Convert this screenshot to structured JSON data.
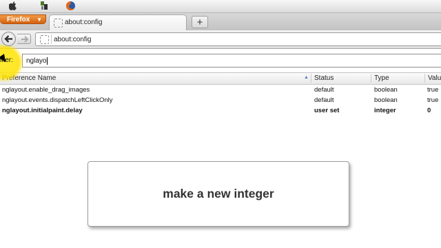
{
  "menubar": {
    "icons": [
      "apple-icon",
      "app-icon",
      "firefox-icon"
    ]
  },
  "firefox_button": {
    "label": "Firefox"
  },
  "tab": {
    "title": "about:config"
  },
  "newtab": {
    "label": "+"
  },
  "navbar": {
    "url": "about:config"
  },
  "filter": {
    "label": "ilter:",
    "value": "nglayo"
  },
  "table": {
    "headers": [
      "Preference Name",
      "Status",
      "Type",
      "Valu"
    ],
    "rows": [
      {
        "name": "nglayout.enable_drag_images",
        "status": "default",
        "type": "boolean",
        "value": "true",
        "bold": false
      },
      {
        "name": "nglayout.events.dispatchLeftClickOnly",
        "status": "default",
        "type": "boolean",
        "value": "true",
        "bold": false
      },
      {
        "name": "nglayout.initialpaint.delay",
        "status": "user set",
        "type": "integer",
        "value": "0",
        "bold": true
      }
    ]
  },
  "overlay": {
    "message": "make a new integer"
  }
}
